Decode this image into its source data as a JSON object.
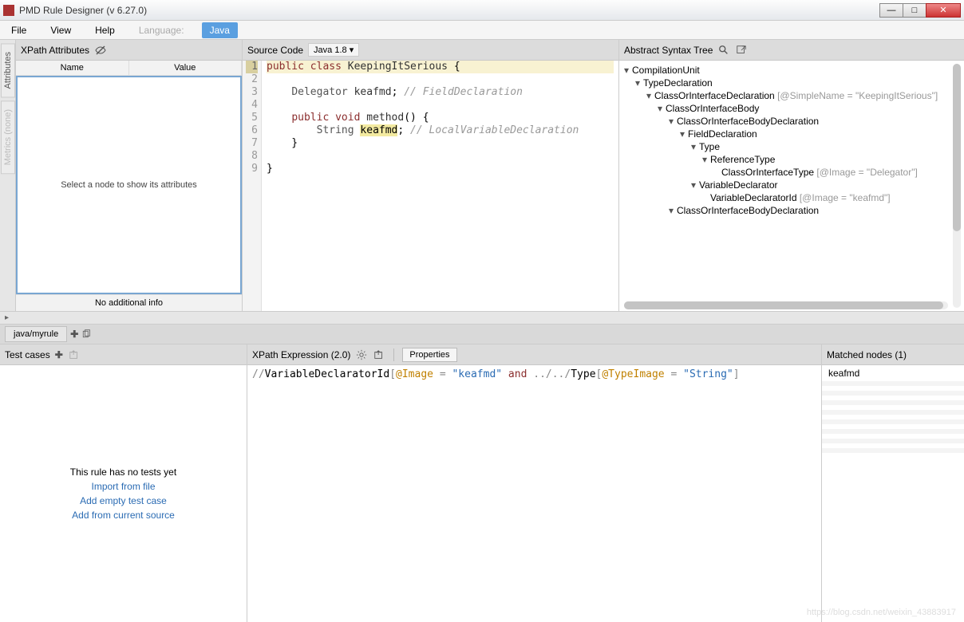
{
  "title": "PMD Rule Designer (v 6.27.0)",
  "menu": {
    "file": "File",
    "view": "View",
    "help": "Help",
    "language_label": "Language:",
    "language_value": "Java"
  },
  "sidebar_tabs": {
    "attributes": "Attributes",
    "metrics": "Metrics   (none)"
  },
  "attributes": {
    "head": "XPath Attributes",
    "col_name": "Name",
    "col_value": "Value",
    "empty": "Select a node to show its attributes",
    "foot": "No additional info"
  },
  "source": {
    "head": "Source Code",
    "lang": "Java 1.8"
  },
  "code_lines": [
    "1",
    "2",
    "3",
    "4",
    "5",
    "6",
    "7",
    "8",
    "9"
  ],
  "code": {
    "l1_kw_public": "public",
    "l1_kw_class": "class",
    "l1_name": "KeepingItSerious",
    "l1_brace": " {",
    "l3_type": "Delegator",
    "l3_id": "keafmd",
    "l3_cm": "// FieldDeclaration",
    "l5_kw_public": "public",
    "l5_kw_void": "void",
    "l5_method": "method",
    "l5_sig": "() {",
    "l6_type": "String",
    "l6_id": "keafmd",
    "l6_cm": "// LocalVariableDeclaration",
    "l7": "    }",
    "l9": "}"
  },
  "ast": {
    "head": "Abstract Syntax Tree",
    "nodes": [
      {
        "indent": 0,
        "label": "CompilationUnit",
        "attr": ""
      },
      {
        "indent": 1,
        "label": "TypeDeclaration",
        "attr": ""
      },
      {
        "indent": 2,
        "label": "ClassOrInterfaceDeclaration",
        "attr": "[@SimpleName = \"KeepingItSerious\"]"
      },
      {
        "indent": 3,
        "label": "ClassOrInterfaceBody",
        "attr": ""
      },
      {
        "indent": 4,
        "label": "ClassOrInterfaceBodyDeclaration",
        "attr": ""
      },
      {
        "indent": 5,
        "label": "FieldDeclaration",
        "attr": ""
      },
      {
        "indent": 6,
        "label": "Type",
        "attr": ""
      },
      {
        "indent": 7,
        "label": "ReferenceType",
        "attr": ""
      },
      {
        "indent": 8,
        "label": "ClassOrInterfaceType",
        "attr": "[@Image = \"Delegator\"]",
        "leaf": true
      },
      {
        "indent": 6,
        "label": "VariableDeclarator",
        "attr": ""
      },
      {
        "indent": 7,
        "label": "VariableDeclaratorId",
        "attr": "[@Image = \"keafmd\"]",
        "leaf": true
      },
      {
        "indent": 4,
        "label": "ClassOrInterfaceBodyDeclaration",
        "attr": ""
      }
    ]
  },
  "ruletab": "java/myrule",
  "tests": {
    "head": "Test cases",
    "empty": "This rule has no tests yet",
    "link_import": "Import from file",
    "link_add_empty": "Add empty test case",
    "link_add_src": "Add from current source"
  },
  "xpath": {
    "head": "XPath Expression (2.0)",
    "props": "Properties",
    "expr_prefix": "//",
    "expr_node1": "VariableDeclaratorId",
    "expr_b1": "[",
    "expr_attr1": "@Image",
    "expr_eq": " = ",
    "expr_str1": "\"keafmd\"",
    "expr_and": " and ",
    "expr_path": "../../",
    "expr_node2": "Type",
    "expr_b2": "[",
    "expr_attr2": "@TypeImage",
    "expr_str2": "\"String\"",
    "expr_close": "]"
  },
  "matches": {
    "head": "Matched nodes (1)",
    "items": [
      "keafmd"
    ]
  },
  "watermark": "https://blog.csdn.net/weixin_43883917"
}
